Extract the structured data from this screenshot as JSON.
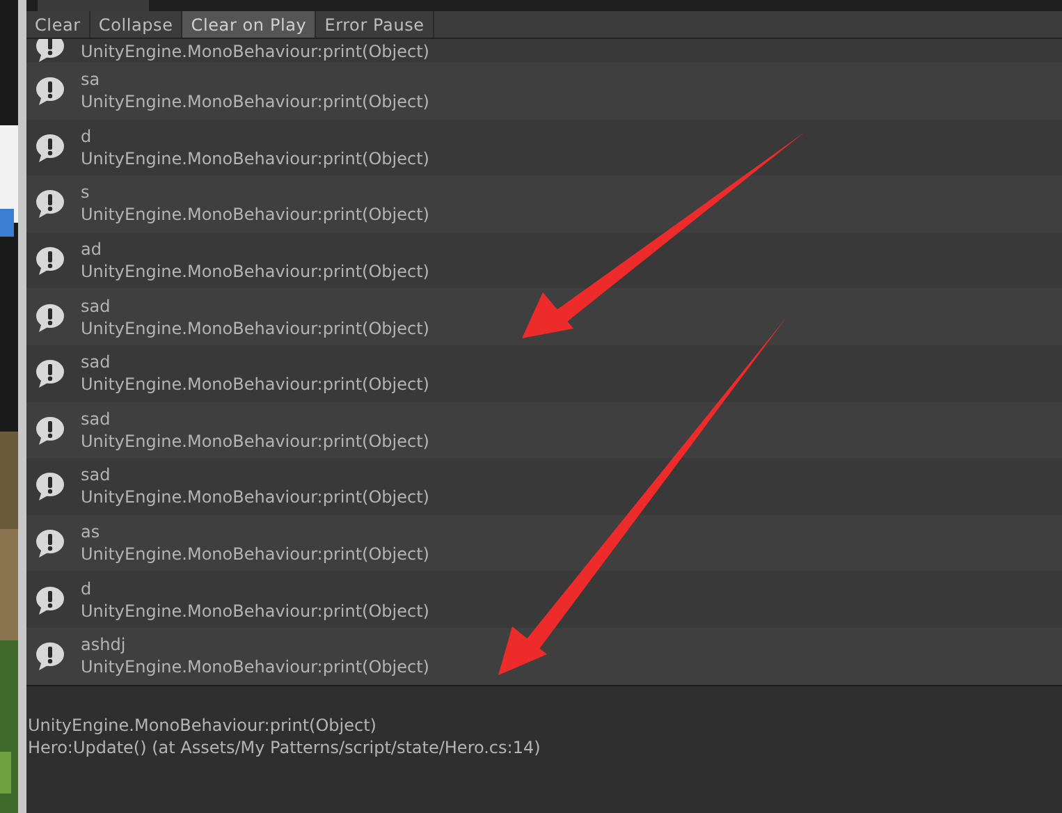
{
  "toolbar": [
    {
      "label": "Clear",
      "selected": false
    },
    {
      "label": "Collapse",
      "selected": false
    },
    {
      "label": "Clear on Play",
      "selected": true
    },
    {
      "label": "Error Pause",
      "selected": false
    }
  ],
  "entries": [
    {
      "kind": "partial",
      "stack": "UnityEngine.MonoBehaviour:print(Object)"
    },
    {
      "kind": "log",
      "message": "sa",
      "stack": "UnityEngine.MonoBehaviour:print(Object)"
    },
    {
      "kind": "log",
      "message": "d",
      "stack": "UnityEngine.MonoBehaviour:print(Object)"
    },
    {
      "kind": "log",
      "message": "s",
      "stack": "UnityEngine.MonoBehaviour:print(Object)"
    },
    {
      "kind": "log",
      "message": "ad",
      "stack": "UnityEngine.MonoBehaviour:print(Object)"
    },
    {
      "kind": "log",
      "message": "sad",
      "stack": "UnityEngine.MonoBehaviour:print(Object)"
    },
    {
      "kind": "log",
      "message": "sad",
      "stack": "UnityEngine.MonoBehaviour:print(Object)"
    },
    {
      "kind": "log",
      "message": "sad",
      "stack": "UnityEngine.MonoBehaviour:print(Object)"
    },
    {
      "kind": "log",
      "message": "sad",
      "stack": "UnityEngine.MonoBehaviour:print(Object)"
    },
    {
      "kind": "log",
      "message": "as",
      "stack": "UnityEngine.MonoBehaviour:print(Object)"
    },
    {
      "kind": "log",
      "message": "d",
      "stack": "UnityEngine.MonoBehaviour:print(Object)"
    },
    {
      "kind": "log",
      "message": "ashdj",
      "stack": "UnityEngine.MonoBehaviour:print(Object)"
    }
  ],
  "detail": [
    "UnityEngine.MonoBehaviour:print(Object)",
    "Hero:Update() (at Assets/My Patterns/script/state/Hero.cs:14)"
  ]
}
